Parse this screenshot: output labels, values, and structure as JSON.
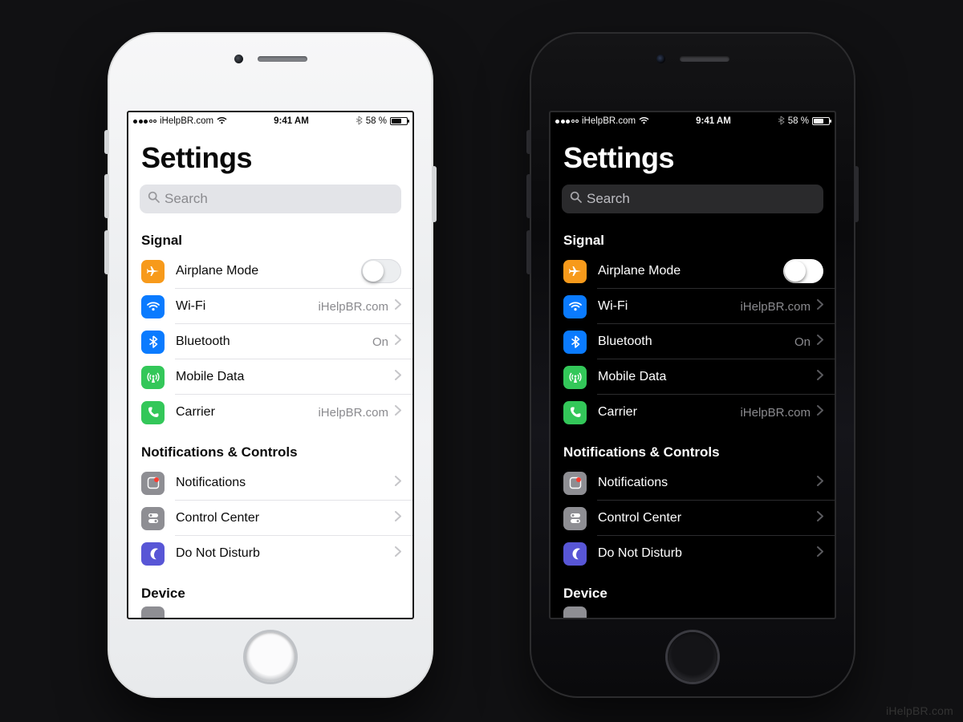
{
  "watermark": "iHelpBR.com",
  "statusbar": {
    "carrier": "iHelpBR.com",
    "time": "9:41 AM",
    "battery_text": "58 %"
  },
  "page_title": "Settings",
  "search": {
    "placeholder": "Search"
  },
  "sections": [
    {
      "title": "Signal",
      "rows": [
        {
          "id": "airplane",
          "label": "Airplane Mode",
          "icon": "airplane-icon",
          "icon_color": "ic-orange",
          "control": "toggle",
          "toggle_on": false
        },
        {
          "id": "wifi",
          "label": "Wi-Fi",
          "icon": "wifi-icon",
          "icon_color": "ic-blue",
          "control": "chevron",
          "value": "iHelpBR.com"
        },
        {
          "id": "bluetooth",
          "label": "Bluetooth",
          "icon": "bluetooth-icon",
          "icon_color": "ic-blue",
          "control": "chevron",
          "value": "On"
        },
        {
          "id": "mobiledata",
          "label": "Mobile Data",
          "icon": "antenna-icon",
          "icon_color": "ic-green",
          "control": "chevron",
          "value": ""
        },
        {
          "id": "carrier",
          "label": "Carrier",
          "icon": "phone-icon",
          "icon_color": "ic-green2",
          "control": "chevron",
          "value": "iHelpBR.com"
        }
      ]
    },
    {
      "title": "Notifications & Controls",
      "rows": [
        {
          "id": "notifications",
          "label": "Notifications",
          "icon": "notifications-icon",
          "icon_color": "ic-grey",
          "control": "chevron",
          "value": ""
        },
        {
          "id": "cc",
          "label": "Control Center",
          "icon": "controlcenter-icon",
          "icon_color": "ic-grey",
          "control": "chevron",
          "value": ""
        },
        {
          "id": "dnd",
          "label": "Do Not Disturb",
          "icon": "moon-icon",
          "icon_color": "ic-purple",
          "control": "chevron",
          "value": ""
        }
      ]
    },
    {
      "title": "Device",
      "rows": []
    }
  ]
}
